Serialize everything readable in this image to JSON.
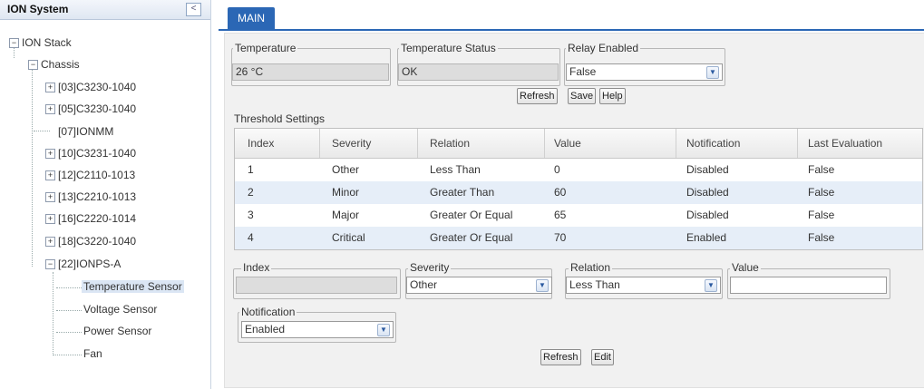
{
  "left_panel": {
    "title": "ION System",
    "collapse_glyph": "<",
    "tree": {
      "root": "ION Stack",
      "chassis": "Chassis",
      "nodes": [
        "[03]C3230-1040",
        "[05]C3230-1040",
        "[07]IONMM",
        "[10]C3231-1040",
        "[12]C2110-1013",
        "[13]C2210-1013",
        "[16]C2220-1014",
        "[18]C3220-1040",
        "[22]IONPS-A"
      ],
      "children": [
        "Temperature Sensor",
        "Voltage Sensor",
        "Power Sensor",
        "Fan"
      ],
      "expander_collapsed": "+",
      "expander_expanded": "−"
    }
  },
  "tabs": [
    "MAIN"
  ],
  "status": {
    "temperature_label": "Temperature",
    "temperature_value": "26 °C",
    "temp_status_label": "Temperature Status",
    "temp_status_value": "OK",
    "relay_label": "Relay Enabled",
    "relay_value": "False"
  },
  "top_buttons": {
    "refresh": "Refresh",
    "save": "Save",
    "help": "Help"
  },
  "threshold": {
    "title": "Threshold Settings",
    "columns": [
      "Index",
      "Severity",
      "Relation",
      "Value",
      "Notification",
      "Last Evaluation"
    ],
    "rows": [
      [
        "1",
        "Other",
        "Less Than",
        "0",
        "Disabled",
        "False"
      ],
      [
        "2",
        "Minor",
        "Greater Than",
        "60",
        "Disabled",
        "False"
      ],
      [
        "3",
        "Major",
        "Greater Or Equal",
        "65",
        "Disabled",
        "False"
      ],
      [
        "4",
        "Critical",
        "Greater Or Equal",
        "70",
        "Enabled",
        "False"
      ]
    ]
  },
  "edit_form": {
    "index_label": "Index",
    "index_value": "",
    "severity_label": "Severity",
    "severity_value": "Other",
    "relation_label": "Relation",
    "relation_value": "Less Than",
    "value_label": "Value",
    "value_value": "",
    "notification_label": "Notification",
    "notification_value": "Enabled"
  },
  "bottom_buttons": {
    "refresh": "Refresh",
    "edit": "Edit"
  },
  "dropdown_glyph": "▼"
}
